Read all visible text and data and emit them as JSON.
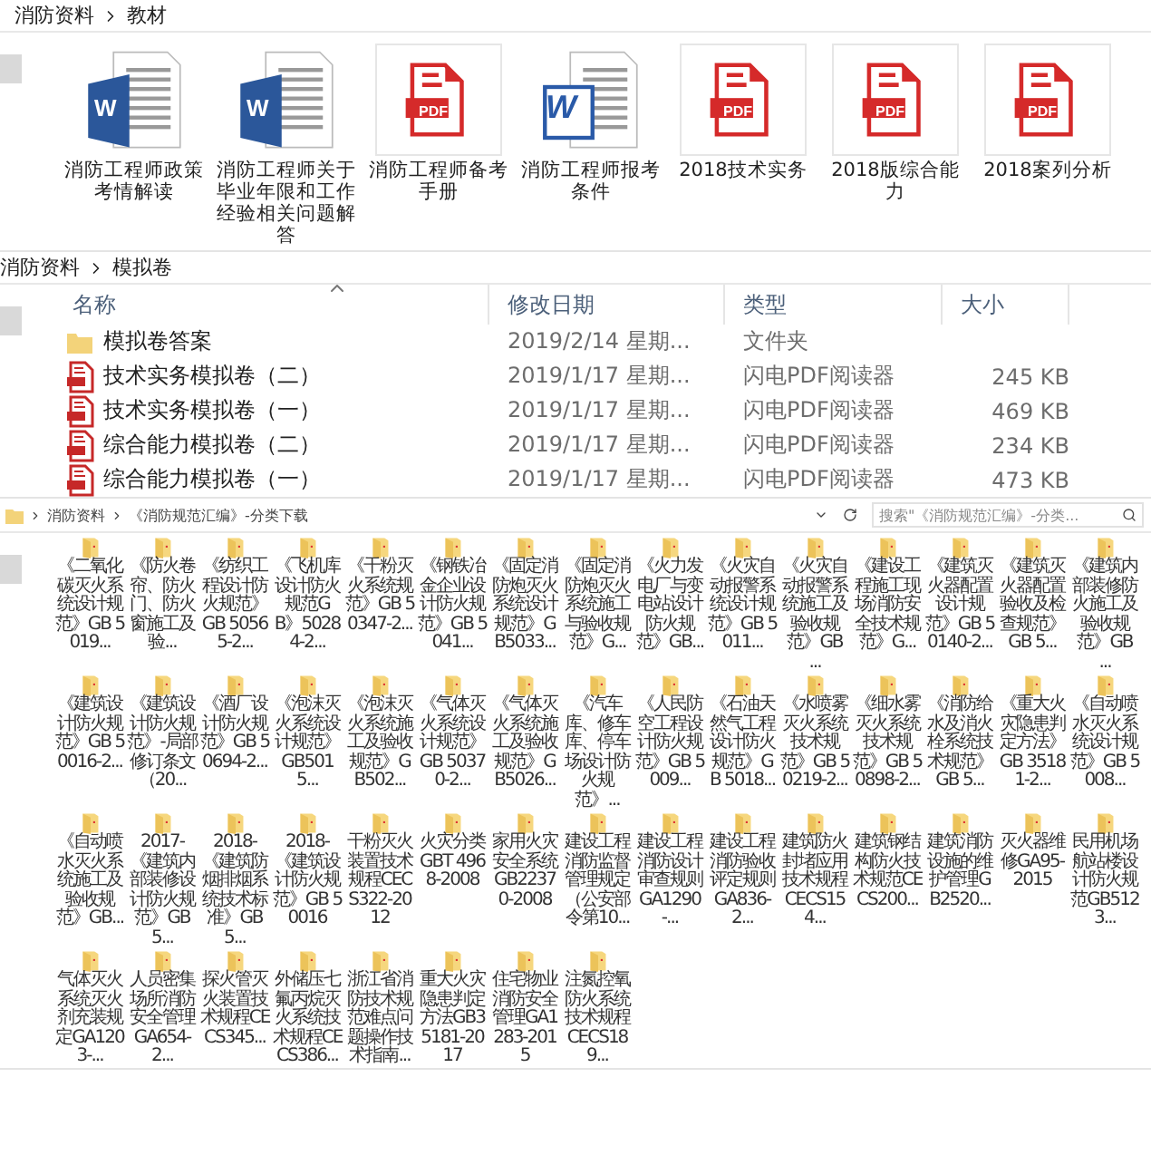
{
  "panes": [
    {
      "breadcrumb": [
        "消防资料",
        "教材"
      ],
      "icons": [
        {
          "kind": "word",
          "badge": "W",
          "label": "消防工程师政策考情解读"
        },
        {
          "kind": "word",
          "badge": "W",
          "label": "消防工程师关于毕业年限和工作经验相关问题解答"
        },
        {
          "kind": "pdf",
          "badge": "PDF",
          "label": "消防工程师备考手册"
        },
        {
          "kind": "word-classic",
          "badge": "W",
          "label": "消防工程师报考条件"
        },
        {
          "kind": "pdf",
          "badge": "PDF",
          "label": "2018技术实务"
        },
        {
          "kind": "pdf",
          "badge": "PDF",
          "label": "2018版综合能力"
        },
        {
          "kind": "pdf",
          "badge": "PDF",
          "label": "2018案列分析"
        }
      ]
    },
    {
      "breadcrumb": [
        "消防资料",
        "模拟卷"
      ],
      "columns": [
        "名称",
        "修改日期",
        "类型",
        "大小"
      ],
      "rows": [
        {
          "kind": "folder",
          "name": "模拟卷答案",
          "date": "2019/2/14 星期...",
          "type": "文件夹"
        },
        {
          "kind": "pdf",
          "name": "技术实务模拟卷（二）",
          "date": "2019/1/17 星期...",
          "type": "闪电PDF阅读器",
          "size": "245 KB"
        },
        {
          "kind": "pdf",
          "name": "技术实务模拟卷（一）",
          "date": "2019/1/17 星期...",
          "type": "闪电PDF阅读器",
          "size": "469 KB"
        },
        {
          "kind": "pdf",
          "name": "综合能力模拟卷（二）",
          "date": "2019/1/17 星期...",
          "type": "闪电PDF阅读器",
          "size": "234 KB"
        },
        {
          "kind": "pdf",
          "name": "综合能力模拟卷（一）",
          "date": "2019/1/17 星期...",
          "type": "闪电PDF阅读器",
          "size": "473 KB"
        }
      ]
    },
    {
      "breadcrumb": [
        "消防资料",
        "《消防规范汇编》-分类下载"
      ],
      "search": {
        "placeholder": "搜索\"《消防规范汇编》-分类..."
      },
      "folders": [
        "《二氧化碳灭火系统设计规范》GB 5019...",
        "《防火卷帘、防火门、防火窗施工及验...",
        "《纺织工程设计防火规范》GB 50565-2...",
        "《飞机库设计防火规范GB》50284-2...",
        "《干粉灭火系统规范》GB 50347-2...",
        "《钢铁冶金企业设计防火规范》GB 5041...",
        "《固定消防炮灭火系统设计规范》GB5033...",
        "《固定消防炮灭火系统施工与验收规范》G...",
        "《火力发电厂与变电站设计防火规范》GB...",
        "《火灾自动报警系统设计规范》GB 5011...",
        "《火灾自动报警系统施工及验收规范》GB ...",
        "《建设工程施工现场消防安全技术规范》G...",
        "《建筑灭火器配置设计规范》GB 50140-2...",
        "《建筑灭火器配置验收及检查规范》GB 5...",
        "《建筑内部装修防火施工及验收规范》GB ...",
        "《建筑设计防火规范》GB 50016-2...",
        "《建筑设计防火规范》-局部修订条文（20...",
        "《酒厂设计防火规范》GB 50694-2...",
        "《泡沫灭火系统设计规范》GB5015...",
        "《泡沫灭火系统施工及验收规范》GB502...",
        "《气体灭火系统设计规范》GB 50370-2...",
        "《气体灭火系统施工及验收规范》GB5026...",
        "《汽车库、修车库、停车场设计防火规范》...",
        "《人民防空工程设计防火规范》GB 5009...",
        "《石油天然气工程设计防火规范》GB 5018...",
        "《水喷雾灭火系统技术规范》GB 50219-2...",
        "《细水雾灭火系统技术规范》GB 50898-2...",
        "《消防给水及消火栓系统技术规范》GB 5...",
        "《重大火灾隐患判定方法》GB 35181-2...",
        "《自动喷水灭火系统设计规范》GB 5008...",
        "《自动喷水灭火系统施工及验收规范》GB...",
        "2017-《建筑内部装修设计防火规范》GB5...",
        "2018-《建筑防烟排烟系统技术标准》GB 5...",
        "2018-《建筑设计防火规范》GB 50016",
        "干粉灭火装置技术规程CECS322-2012",
        "火灾分类GBT 4968-2008",
        "家用火灾安全系统GB22370-2008",
        "建设工程消防监督管理规定（公安部令第10...",
        "建设工程消防设计审查规则GA1290-...",
        "建设工程消防验收评定规则GA836-2...",
        "建筑防火封堵应用技术规程CECS154...",
        "建筑钢结构防火技术规范CECS200...",
        "建筑消防设施的维护管理GB2520...",
        "灭火器维修GA95-2015",
        "民用机场航站楼设计防火规范GB5123...",
        "气体灭火系统灭火剂充装规定GA1203-...",
        "人员密集场所消防安全管理GA654-2...",
        "探火管灭火装置技术规程CECS345...",
        "外储压七氟丙烷灭火系统技术规程CECS386...",
        "浙江省消防技术规范难点问题操作技术指南...",
        "重大火灾隐患判定方法GB35181-2017",
        "住宅物业消防安全管理GA1283-2015",
        "注氮控氧防火系统技术规程CECS189..."
      ]
    }
  ]
}
